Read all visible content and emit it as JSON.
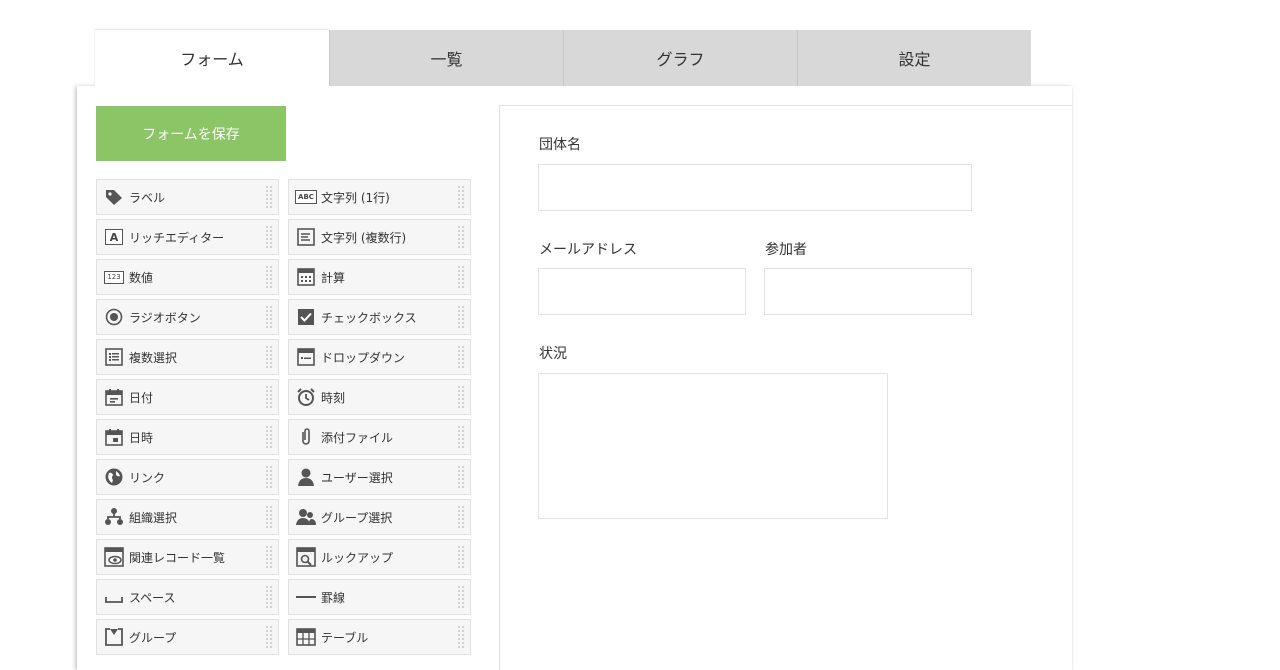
{
  "tabs": [
    {
      "label": "フォーム"
    },
    {
      "label": "一覧"
    },
    {
      "label": "グラフ"
    },
    {
      "label": "設定"
    }
  ],
  "toolbar": {
    "save_label": "フォームを保存"
  },
  "palette": {
    "rows": [
      [
        {
          "label": "ラベル",
          "icon": "tag-icon"
        },
        {
          "label": "文字列 (1行)",
          "icon": "abc-icon"
        }
      ],
      [
        {
          "label": "リッチエディター",
          "icon": "rich-editor-icon"
        },
        {
          "label": "文字列 (複数行)",
          "icon": "multiline-text-icon"
        }
      ],
      [
        {
          "label": "数値",
          "icon": "number-icon"
        },
        {
          "label": "計算",
          "icon": "calculator-icon"
        }
      ],
      [
        {
          "label": "ラジオボタン",
          "icon": "radio-icon"
        },
        {
          "label": "チェックボックス",
          "icon": "checkbox-icon"
        }
      ],
      [
        {
          "label": "複数選択",
          "icon": "multi-select-icon"
        },
        {
          "label": "ドロップダウン",
          "icon": "dropdown-icon"
        }
      ],
      [
        {
          "label": "日付",
          "icon": "calendar-icon"
        },
        {
          "label": "時刻",
          "icon": "clock-icon"
        }
      ],
      [
        {
          "label": "日時",
          "icon": "datetime-icon"
        },
        {
          "label": "添付ファイル",
          "icon": "paperclip-icon"
        }
      ],
      [
        {
          "label": "リンク",
          "icon": "globe-icon"
        },
        {
          "label": "ユーザー選択",
          "icon": "user-icon"
        }
      ],
      [
        {
          "label": "組織選択",
          "icon": "organization-icon"
        },
        {
          "label": "グループ選択",
          "icon": "group-icon"
        }
      ],
      [
        {
          "label": "関連レコード一覧",
          "icon": "related-records-icon"
        },
        {
          "label": "ルックアップ",
          "icon": "lookup-icon"
        }
      ],
      [
        {
          "label": "スペース",
          "icon": "space-icon"
        },
        {
          "label": "罫線",
          "icon": "line-icon"
        }
      ],
      [
        {
          "label": "グループ",
          "icon": "field-group-icon"
        },
        {
          "label": "テーブル",
          "icon": "table-icon"
        }
      ]
    ]
  },
  "form": {
    "field1_label": "団体名",
    "field2_label": "メールアドレス",
    "field3_label": "参加者",
    "field4_label": "状況"
  },
  "colors": {
    "accent": "#8bc566",
    "tab_inactive": "#d8d8d8"
  }
}
